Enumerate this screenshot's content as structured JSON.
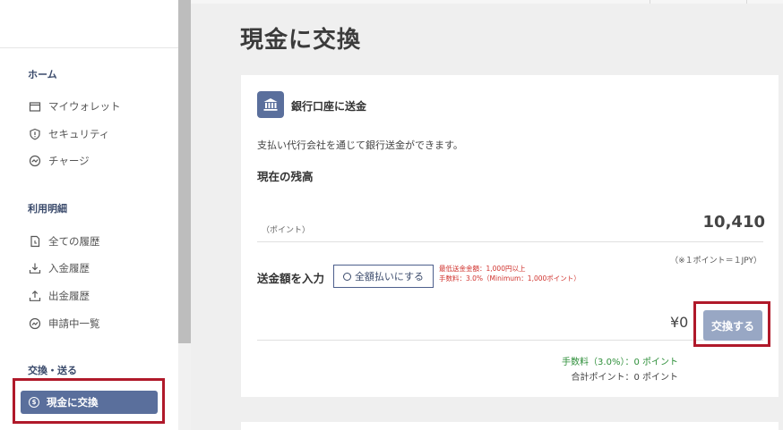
{
  "sidebar": {
    "sections": [
      {
        "title": "ホーム",
        "items": [
          {
            "label": "マイウォレット",
            "icon": "wallet-icon"
          },
          {
            "label": "セキュリティ",
            "icon": "shield-icon"
          },
          {
            "label": "チャージ",
            "icon": "charge-icon"
          }
        ]
      },
      {
        "title": "利用明細",
        "items": [
          {
            "label": "全ての履歴",
            "icon": "document-icon"
          },
          {
            "label": "入金履歴",
            "icon": "download-icon"
          },
          {
            "label": "出金履歴",
            "icon": "upload-icon"
          },
          {
            "label": "申請中一覧",
            "icon": "pending-icon"
          }
        ]
      },
      {
        "title": "交換・送る",
        "items": [
          {
            "label": "現金に交換",
            "icon": "coin-icon",
            "active": true
          }
        ]
      }
    ]
  },
  "page": {
    "title": "現金に交換"
  },
  "card": {
    "title": "銀行口座に送金",
    "description": "支払い代行会社を通じて銀行送金ができます。",
    "balance_title": "現在の残高",
    "points_label": "（ポイント）",
    "balance_value": "10,410",
    "rate_note": "（※１ポイント＝１JPY）",
    "amount_label": "送金額を入力",
    "fullpay_label": "全額払いにする",
    "limit_notes": [
      "最低送金金額：1,000円以上",
      "手数料：3.0%（Minimum：1,000ポイント）"
    ],
    "amount_value": "¥0",
    "exchange_label": "交換する",
    "fee_line": "手数料（3.0%）：0 ポイント",
    "total_line": "合計ポイント：0 ポイント"
  },
  "colors": {
    "accent": "#5a6f9c",
    "highlight": "#b0192a",
    "fee_text": "#2e8f3a",
    "warning_text": "#d0332e"
  }
}
